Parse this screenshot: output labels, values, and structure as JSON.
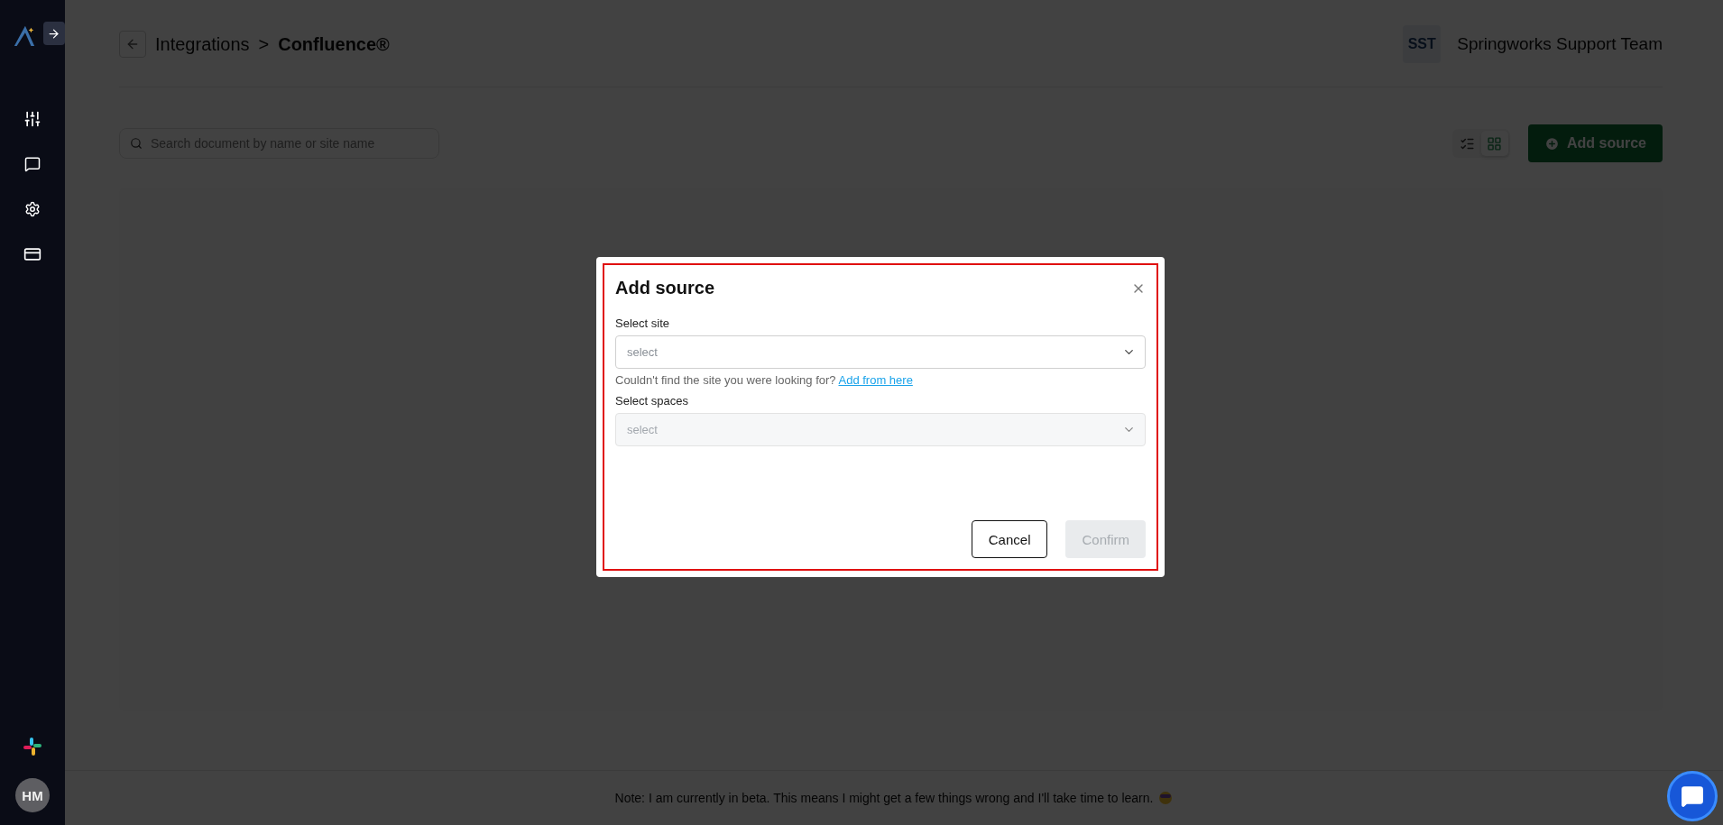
{
  "sidebar": {
    "nav": [
      {
        "kind": "sliders"
      },
      {
        "kind": "chat"
      },
      {
        "kind": "settings"
      },
      {
        "kind": "billing"
      }
    ],
    "user": {
      "initials": "HM"
    }
  },
  "header": {
    "breadcrumb": {
      "parent": "Integrations",
      "separator": ">",
      "current": "Confluence®"
    },
    "team": {
      "initials": "SST",
      "name": "Springworks Support Team"
    }
  },
  "toolbar": {
    "search": {
      "placeholder": "Search document by name or site name"
    },
    "views": [
      {
        "kind": "list",
        "selected": false
      },
      {
        "kind": "grid",
        "selected": true
      }
    ],
    "add_button": "Add source"
  },
  "footer": {
    "note": "Note: I am currently in beta. This means I might get a few things wrong and I'll take time to learn."
  },
  "modal": {
    "title": "Add source",
    "highlighted": true,
    "fields": [
      {
        "label": "Select site",
        "placeholder": "select",
        "disabled": false
      },
      {
        "label": "Select spaces",
        "placeholder": "select",
        "disabled": true
      }
    ],
    "helper": {
      "text": "Couldn't find the site you were looking for?",
      "link": "Add from here"
    },
    "buttons": [
      {
        "label": "Cancel",
        "kind": "secondary",
        "disabled": false
      },
      {
        "label": "Confirm",
        "kind": "primary",
        "disabled": true
      }
    ]
  }
}
